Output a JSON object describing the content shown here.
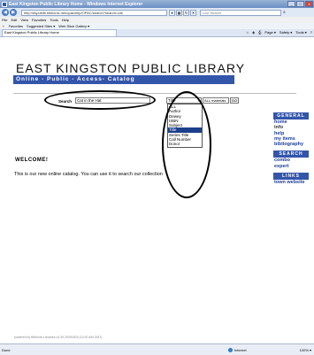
{
  "window": {
    "title": "East Kingston Public Library Home - Windows Internet Explorer",
    "buttons": [
      "_",
      "□",
      "X"
    ]
  },
  "address_bar": {
    "url": "http://ekpublib.biblionix.net/opac/ekp/OPAC/search?search=cat",
    "live_search_placeholder": "Live Search"
  },
  "menu": [
    "File",
    "Edit",
    "View",
    "Favorites",
    "Tools",
    "Help"
  ],
  "favorites_bar": {
    "favorites_label": "Favorites",
    "suggested_sites": "Suggested Sites ▾",
    "web_slice": "Web Slice Gallery ▾"
  },
  "tab": {
    "title": "East Kingston Public Library Home",
    "tools": [
      "Page ▾",
      "Safety ▾",
      "Tools ▾"
    ]
  },
  "library": {
    "title": "EAST KINGSTON PUBLIC LIBRARY",
    "subtitle": "Online - Public - Access- Catalog"
  },
  "search": {
    "label": "Search",
    "value": "Cat in the Hat",
    "field_selected": "Title",
    "material_selected": "ALL materials",
    "go_label": "GO",
    "field_options": [
      "ALL",
      "Author",
      "Dewey",
      "ISBN",
      "Subject",
      "Title",
      "Series Title",
      "Call Number",
      "Donor"
    ],
    "field_highlight_index": 5
  },
  "content": {
    "welcome_heading": "WELCOME!",
    "intro": "This is our new online catalog. You can use it to search our collection"
  },
  "sidebar": {
    "general": {
      "heading": "GENERAL",
      "links": [
        "home",
        "info",
        "help",
        "my items",
        "bibliography"
      ]
    },
    "search_section": {
      "heading": "SEARCH",
      "links": [
        "combo",
        "expert"
      ]
    },
    "links_section": {
      "heading": "LINKS",
      "links": [
        "town website"
      ]
    }
  },
  "footer": {
    "powered_by": "powered by Biblionix Libraries v3.39.20090303 (10:00 AM GMT)"
  },
  "status_bar": {
    "status": "Done",
    "zone": "Internet",
    "zoom": "100% ▾"
  }
}
